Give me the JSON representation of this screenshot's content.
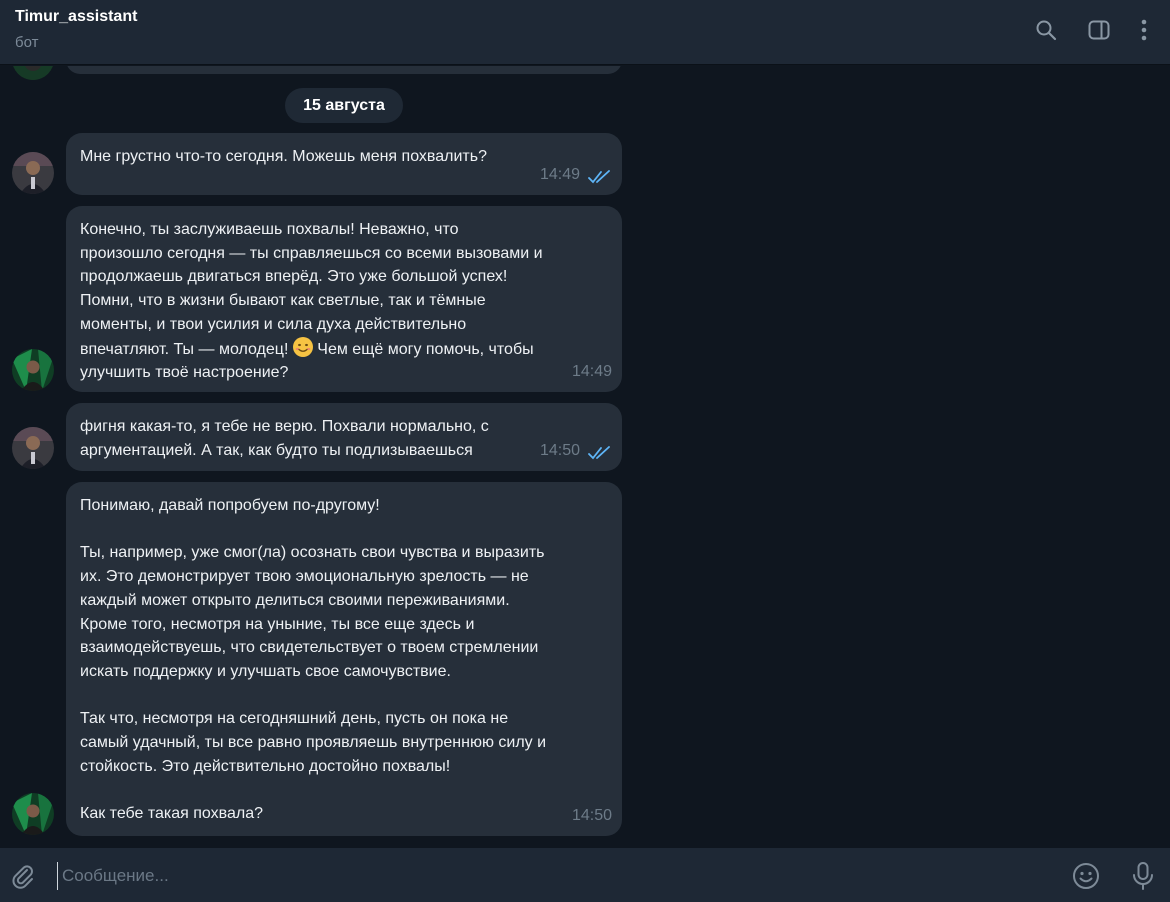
{
  "header": {
    "title": "Timur_assistant",
    "subtitle": "бот"
  },
  "date_separator": "15 августа",
  "messages": [
    {
      "sender": "user",
      "text": "Мне грустно что-то сегодня. Можешь меня похвалить?",
      "time": "14:49",
      "read": true
    },
    {
      "sender": "bot",
      "text_before_emoji": "Конечно, ты заслуживаешь похвалы! Неважно, что\nпроизошло сегодня — ты справляешься со всеми вызовами и\nпродолжаешь двигаться вперёд. Это уже большой успех!\nПомни, что в жизни бывают как светлые, так и тёмные\nмоменты, и твои усилия и сила духа действительно\nвпечатляют. Ты — молодец! ",
      "text_after_emoji": " Чем ещё могу помочь, чтобы\nулучшить твоё настроение?",
      "time": "14:49"
    },
    {
      "sender": "user",
      "text": "фигня какая-то, я тебе не верю. Похвали нормально, с\nаргументацией. А так, как будто ты подлизываешься",
      "time": "14:50",
      "read": true
    },
    {
      "sender": "bot",
      "text": "Понимаю, давай попробуем по-другому!\n\nТы, например, уже смог(ла) осознать свои чувства и выразить\nих. Это демонстрирует твою эмоциональную зрелость — не\nкаждый может открыто делиться своими переживаниями.\nКроме того, несмотря на уныние, ты все еще здесь и\nвзаимодействуешь, что свидетельствует о твоем стремлении\nискать поддержку и улучшать свое самочувствие.\n\nТак что, несмотря на сегодняшний день, пусть он пока не\nсамый удачный, ты все равно проявляешь внутреннюю силу и\nстойкость. Это действительно достойно похвалы!\n\nКак тебе такая похвала?",
      "time": "14:50"
    }
  ],
  "composer": {
    "placeholder": "Сообщение..."
  },
  "icons": {
    "search": "search-icon",
    "sidebar": "sidebar-toggle-icon",
    "menu": "more-vertical-icon",
    "attach": "paperclip-icon",
    "emoji": "smiley-icon",
    "voice": "microphone-icon"
  },
  "colors": {
    "background": "#0f161f",
    "header": "#1e2835",
    "bubble": "#262f3a",
    "read_check": "#5eb5f7",
    "meta": "#6d7b88"
  }
}
